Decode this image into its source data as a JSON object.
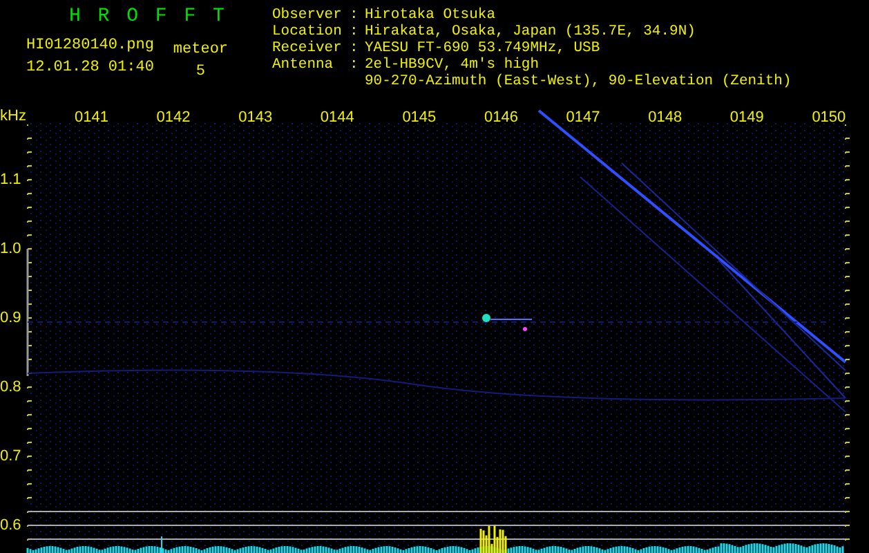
{
  "app_title": "H R O F F T",
  "file_name": "HI01280140.png",
  "timestamp": "12.01.28 01:40",
  "meteor": {
    "label": "meteor",
    "count": "5"
  },
  "station_info": [
    {
      "label": "Observer",
      "separator": ":",
      "lines": [
        "Hirotaka Otsuka"
      ]
    },
    {
      "label": "Location",
      "separator": ":",
      "lines": [
        "Hirakata, Osaka, Japan (135.7E, 34.9N)"
      ]
    },
    {
      "label": "Receiver",
      "separator": ":",
      "lines": [
        "YAESU FT-690 53.749MHz, USB"
      ]
    },
    {
      "label": "Antenna",
      "separator": ":",
      "lines": [
        "2el-HB9CV, 4m's high",
        "90-270-Azimuth (East-West), 90-Elevation (Zenith)"
      ]
    }
  ],
  "spectrogram": {
    "y_unit": "kHz",
    "y_labels": [
      "1.1",
      "1.0",
      "0.9",
      "0.8",
      "0.7",
      "0.6"
    ],
    "x_labels": [
      "0141",
      "0142",
      "0143",
      "0144",
      "0145",
      "0146",
      "0147",
      "0148",
      "0149",
      "0150"
    ]
  }
}
